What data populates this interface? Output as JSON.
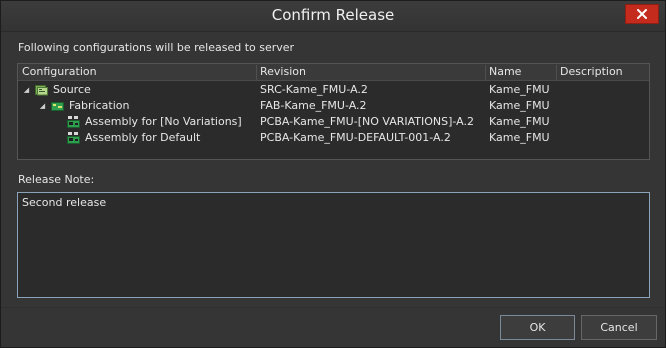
{
  "window": {
    "title": "Confirm Release",
    "close_icon": "close-icon"
  },
  "intro_text": "Following configurations will be released to server",
  "grid": {
    "columns": [
      "Configuration",
      "Revision",
      "Name",
      "Description"
    ],
    "rows": [
      {
        "configuration": "Source",
        "revision": "SRC-Kame_FMU-A.2",
        "name": "Kame_FMU",
        "description": "",
        "icon": "source-folder-icon",
        "expanded": true
      },
      {
        "configuration": "Fabrication",
        "revision": "FAB-Kame_FMU-A.2",
        "name": "Kame_FMU",
        "description": "",
        "icon": "pcb-board-icon",
        "expanded": true
      },
      {
        "configuration": "Assembly for [No Variations]",
        "revision": "PCBA-Kame_FMU-[NO VARIATIONS]-A.2",
        "name": "Kame_FMU",
        "description": "",
        "icon": "assembly-icon"
      },
      {
        "configuration": "Assembly for Default",
        "revision": "PCBA-Kame_FMU-DEFAULT-001-A.2",
        "name": "Kame_FMU",
        "description": "",
        "icon": "assembly-icon"
      }
    ]
  },
  "release_note": {
    "label": "Release Note:",
    "value": "Second release"
  },
  "buttons": {
    "ok": "OK",
    "cancel": "Cancel"
  }
}
